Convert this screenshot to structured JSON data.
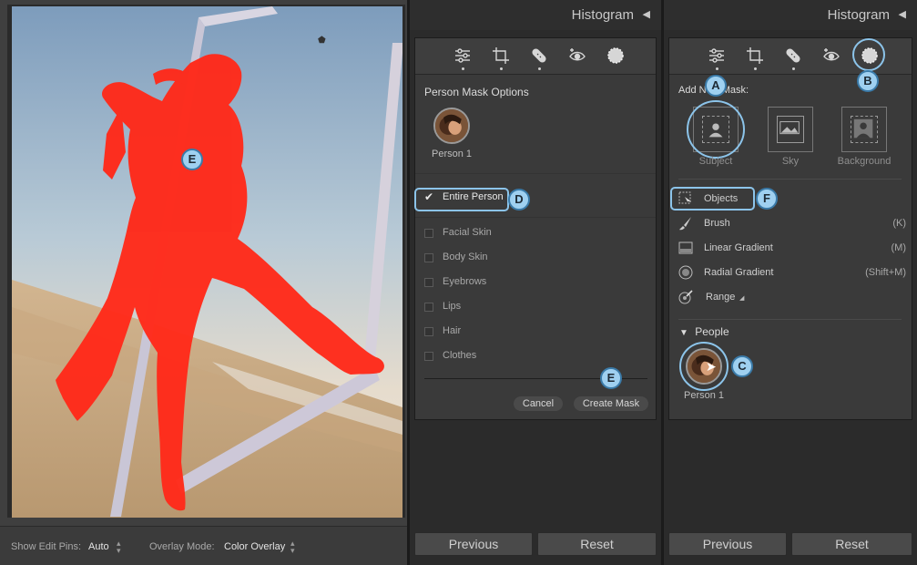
{
  "toolbar": {
    "show_edit_pins_label": "Show Edit Pins:",
    "show_edit_pins_value": "Auto",
    "overlay_mode_label": "Overlay Mode:",
    "overlay_mode_value": "Color Overlay"
  },
  "panel_left": {
    "header_title": "Histogram",
    "section_title": "Person Mask Options",
    "person_label": "Person 1",
    "entire_person_label": "Entire Person",
    "parts": [
      "Facial Skin",
      "Body Skin",
      "Eyebrows",
      "Lips",
      "Hair",
      "Clothes"
    ],
    "cancel_label": "Cancel",
    "create_label": "Create Mask",
    "previous_label": "Previous",
    "reset_label": "Reset"
  },
  "panel_right": {
    "header_title": "Histogram",
    "add_mask_label": "Add New Mask:",
    "subject_label": "Subject",
    "sky_label": "Sky",
    "background_label": "Background",
    "objects_label": "Objects",
    "brush_label": "Brush",
    "brush_key": "(K)",
    "linear_label": "Linear Gradient",
    "linear_key": "(M)",
    "radial_label": "Radial Gradient",
    "radial_key": "(Shift+M)",
    "range_label": "Range",
    "people_label": "People",
    "person_label": "Person 1",
    "previous_label": "Previous",
    "reset_label": "Reset"
  },
  "callouts": {
    "a": "A",
    "b": "B",
    "c": "C",
    "d": "D",
    "e_panel": "E",
    "e_photo": "E",
    "f": "F"
  },
  "colors": {
    "overlay_red": "#ff2a1a",
    "callout_fill": "#9fd0f0",
    "highlight_blue": "#8cc4ea"
  }
}
